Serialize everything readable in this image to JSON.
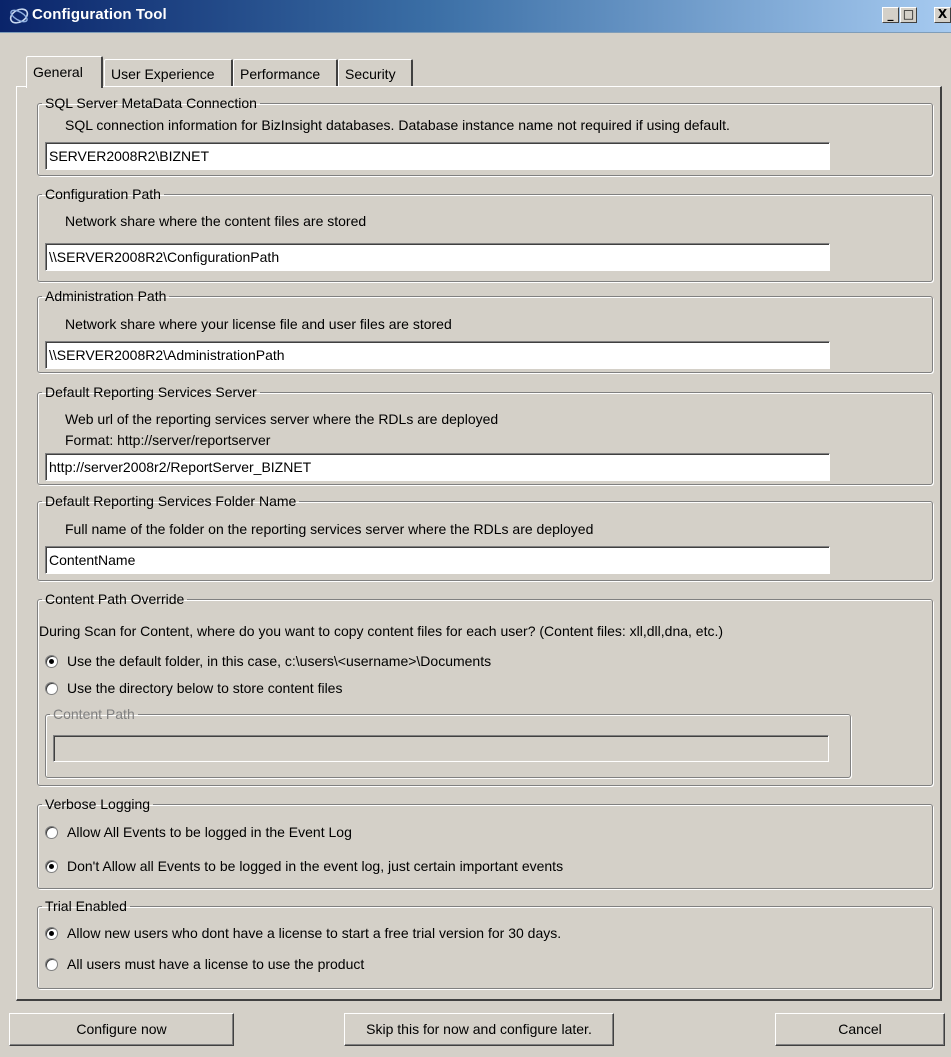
{
  "window": {
    "title": "Configuration Tool",
    "controls": {
      "minimize": "_",
      "maximize": "□",
      "close": "X"
    }
  },
  "tabs": [
    {
      "label": "General",
      "active": true
    },
    {
      "label": "User Experience",
      "active": false
    },
    {
      "label": "Performance",
      "active": false
    },
    {
      "label": "Security",
      "active": false
    }
  ],
  "sql": {
    "legend": "SQL Server MetaData Connection",
    "help": "SQL connection information for BizInsight databases.  Database instance name not required if using default.",
    "value": "SERVER2008R2\\BIZNET"
  },
  "config_path": {
    "legend": "Configuration Path",
    "help": "Network share where the content files are stored",
    "value": "\\\\SERVER2008R2\\ConfigurationPath"
  },
  "admin_path": {
    "legend": "Administration Path",
    "help": "Network share where your license file and user files are stored",
    "value": "\\\\SERVER2008R2\\AdministrationPath"
  },
  "rs_server": {
    "legend": "Default Reporting Services Server",
    "help": "Web url  of the reporting services server where the RDLs are deployed",
    "format": "Format:  http://server/reportserver",
    "value": "http://server2008r2/ReportServer_BIZNET"
  },
  "rs_folder": {
    "legend": "Default Reporting Services Folder Name",
    "help": "Full name of the folder on the reporting services server where the RDLs are deployed",
    "value": "ContentName"
  },
  "content_override": {
    "legend": "Content Path Override",
    "help": "During Scan for Content, where do you want to copy content files for each user? (Content files: xll,dll,dna, etc.)",
    "option_default": "Use the default folder, in this case, c:\\users\\<username>\\Documents",
    "option_directory": "Use the directory below to store content files",
    "selected": "default",
    "content_path_legend": "Content Path",
    "content_path_value": ""
  },
  "verbose": {
    "legend": "Verbose Logging",
    "option_all": "Allow All Events to be logged in the Event Log",
    "option_important": "Don't Allow all Events to be logged in the event log, just certain important events",
    "selected": "important"
  },
  "trial": {
    "legend": "Trial Enabled",
    "option_allow": "Allow new users who dont have a license to start a free trial version for 30 days.",
    "option_require": "All users must have a license to use the product",
    "selected": "allow"
  },
  "buttons": {
    "configure": "Configure now",
    "skip": "Skip this for now and configure later.",
    "cancel": "Cancel"
  }
}
